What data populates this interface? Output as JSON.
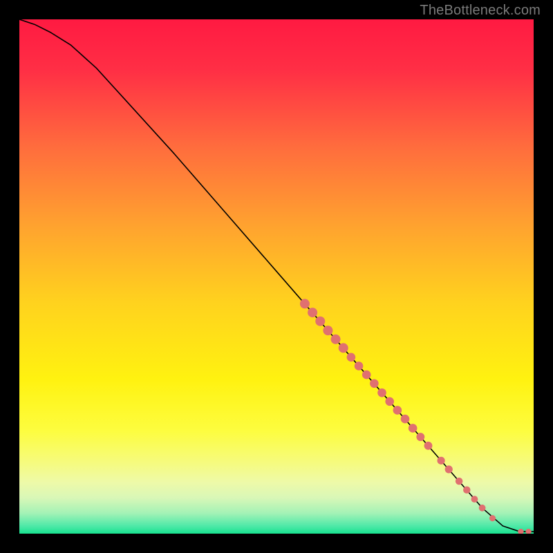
{
  "attribution": "TheBottleneck.com",
  "colors": {
    "frame": "#000000",
    "curve": "#000000",
    "marker": "#e07070",
    "gradient_stops": [
      {
        "offset": 0.0,
        "color": "#ff1a42"
      },
      {
        "offset": 0.1,
        "color": "#ff2f45"
      },
      {
        "offset": 0.25,
        "color": "#ff6d3d"
      },
      {
        "offset": 0.4,
        "color": "#ffa22f"
      },
      {
        "offset": 0.55,
        "color": "#ffd21e"
      },
      {
        "offset": 0.7,
        "color": "#fff210"
      },
      {
        "offset": 0.8,
        "color": "#fdfd3f"
      },
      {
        "offset": 0.86,
        "color": "#f6fb7c"
      },
      {
        "offset": 0.9,
        "color": "#eefaa8"
      },
      {
        "offset": 0.93,
        "color": "#d9f7b7"
      },
      {
        "offset": 0.96,
        "color": "#a4f2b6"
      },
      {
        "offset": 0.985,
        "color": "#4fe9a8"
      },
      {
        "offset": 1.0,
        "color": "#18e28f"
      }
    ]
  },
  "chart_data": {
    "type": "line",
    "title": "",
    "xlabel": "",
    "ylabel": "",
    "xlim": [
      0,
      100
    ],
    "ylim": [
      0,
      100
    ],
    "series": [
      {
        "name": "curve",
        "x": [
          0,
          3,
          6,
          10,
          15,
          20,
          30,
          40,
          50,
          60,
          70,
          80,
          90,
          94,
          97,
          98,
          100
        ],
        "y": [
          100,
          99,
          97.5,
          95,
          90.5,
          85,
          74,
          62.5,
          51,
          39.5,
          28,
          16.5,
          5,
          1.5,
          0.5,
          0.4,
          0.4
        ]
      }
    ],
    "markers": [
      {
        "x": 55.5,
        "y": 44.7,
        "r": 1.0
      },
      {
        "x": 57.0,
        "y": 43.0,
        "r": 1.0
      },
      {
        "x": 58.5,
        "y": 41.3,
        "r": 1.0
      },
      {
        "x": 60.0,
        "y": 39.5,
        "r": 1.0
      },
      {
        "x": 61.5,
        "y": 37.8,
        "r": 1.0
      },
      {
        "x": 63.0,
        "y": 36.1,
        "r": 1.0
      },
      {
        "x": 64.5,
        "y": 34.3,
        "r": 0.9
      },
      {
        "x": 66.0,
        "y": 32.6,
        "r": 0.9
      },
      {
        "x": 67.5,
        "y": 30.9,
        "r": 0.9
      },
      {
        "x": 69.0,
        "y": 29.2,
        "r": 0.9
      },
      {
        "x": 70.5,
        "y": 27.4,
        "r": 0.9
      },
      {
        "x": 72.0,
        "y": 25.7,
        "r": 0.9
      },
      {
        "x": 73.5,
        "y": 24.0,
        "r": 0.9
      },
      {
        "x": 75.0,
        "y": 22.3,
        "r": 0.9
      },
      {
        "x": 76.5,
        "y": 20.5,
        "r": 0.9
      },
      {
        "x": 78.0,
        "y": 18.8,
        "r": 0.85
      },
      {
        "x": 79.5,
        "y": 17.1,
        "r": 0.85
      },
      {
        "x": 82.0,
        "y": 14.2,
        "r": 0.8
      },
      {
        "x": 83.5,
        "y": 12.5,
        "r": 0.8
      },
      {
        "x": 85.5,
        "y": 10.2,
        "r": 0.75
      },
      {
        "x": 87.0,
        "y": 8.5,
        "r": 0.75
      },
      {
        "x": 88.5,
        "y": 6.7,
        "r": 0.7
      },
      {
        "x": 90.0,
        "y": 5.0,
        "r": 0.7
      },
      {
        "x": 92.0,
        "y": 3.0,
        "r": 0.65
      },
      {
        "x": 97.5,
        "y": 0.4,
        "r": 0.6
      },
      {
        "x": 99.0,
        "y": 0.4,
        "r": 0.6
      }
    ]
  }
}
